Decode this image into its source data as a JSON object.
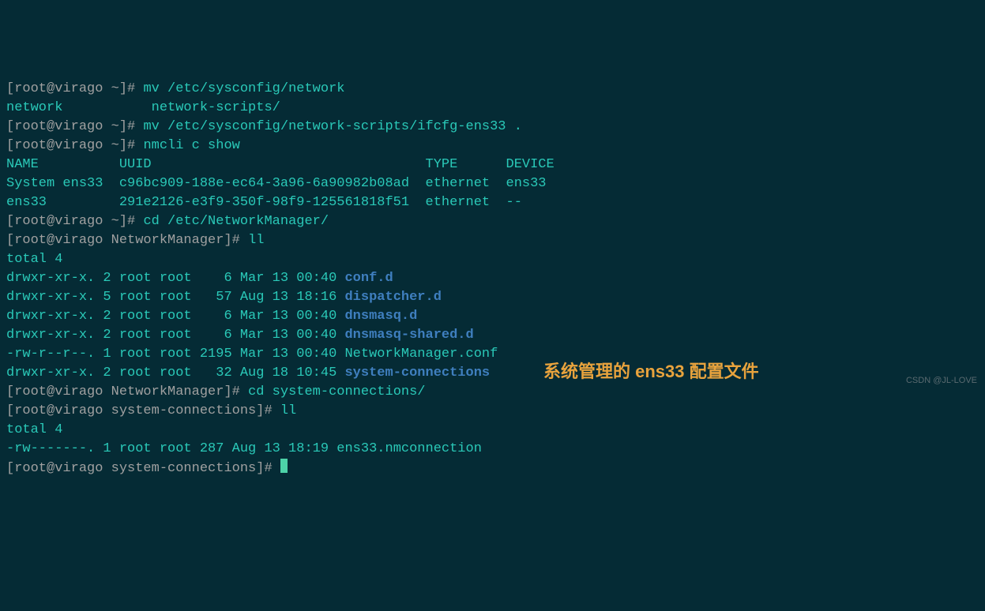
{
  "prompt_home": "[root@virago ~]#",
  "prompt_nm": "[root@virago NetworkManager]#",
  "prompt_sc": "[root@virago system-connections]#",
  "cmd": {
    "mv1": "mv /etc/sysconfig/network",
    "tab1_a": "network",
    "tab1_b": "network-scripts/",
    "mv2": "mv /etc/sysconfig/network-scripts/ifcfg-ens33 .",
    "nmcli": "nmcli c show",
    "cd1": "cd /etc/NetworkManager/",
    "ll": "ll",
    "cd2": "cd system-connections/"
  },
  "nmcli_head": {
    "name": "NAME",
    "uuid": "UUID",
    "type": "TYPE",
    "device": "DEVICE"
  },
  "nmcli_rows": [
    {
      "name": "System ens33",
      "uuid": "c96bc909-188e-ec64-3a96-6a90982b08ad",
      "type": "ethernet",
      "device": "ens33"
    },
    {
      "name": "ens33",
      "uuid": "291e2126-e3f9-350f-98f9-125561818f51",
      "type": "ethernet",
      "device": "--"
    }
  ],
  "total4": "total 4",
  "ls_nm": [
    {
      "perm": "drwxr-xr-x. 2 root root    6 Mar 13 00:40",
      "name": "conf.d",
      "dir": true
    },
    {
      "perm": "drwxr-xr-x. 5 root root   57 Aug 13 18:16",
      "name": "dispatcher.d",
      "dir": true
    },
    {
      "perm": "drwxr-xr-x. 2 root root    6 Mar 13 00:40",
      "name": "dnsmasq.d",
      "dir": true
    },
    {
      "perm": "drwxr-xr-x. 2 root root    6 Mar 13 00:40",
      "name": "dnsmasq-shared.d",
      "dir": true
    },
    {
      "perm": "-rw-r--r--. 1 root root 2195 Mar 13 00:40",
      "name": "NetworkManager.conf",
      "dir": false
    },
    {
      "perm": "drwxr-xr-x. 2 root root   32 Aug 18 10:45",
      "name": "system-connections",
      "dir": true
    }
  ],
  "ls_sc": [
    {
      "perm": "-rw-------. 1 root root 287 Aug 13 18:19",
      "name": "ens33.nmconnection",
      "dir": false
    }
  ],
  "annotation": "系统管理的 ens33 配置文件",
  "watermark": "CSDN @JL-LOVE"
}
